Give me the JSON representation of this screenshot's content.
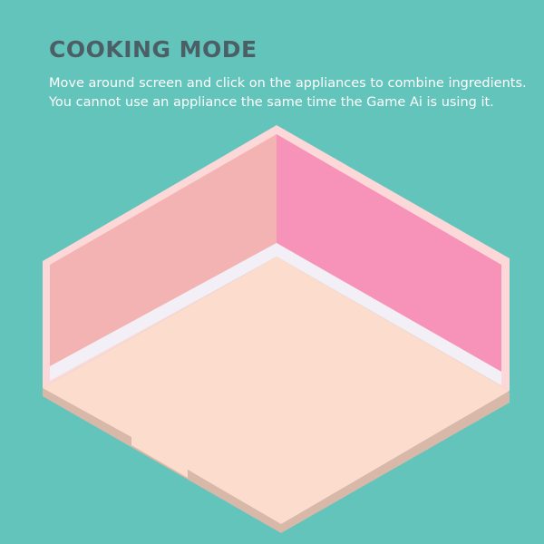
{
  "header": {
    "title": "COOKING MODE",
    "instructions": "Move around screen and click on the appliances to combine ingredients. You cannot use an appliance the same time the Game Ai is using it."
  },
  "colors": {
    "background": "#62c4bb",
    "title_text": "#4c5f66",
    "body_text": "#ffffff",
    "left_wall": "#f4b3b3",
    "right_wall": "#f792b9",
    "floor": "#fbdccd",
    "wall_trim": "#fcd8d8",
    "floor_base": "#d8b8a8",
    "baseboard": "#f3eff6"
  }
}
